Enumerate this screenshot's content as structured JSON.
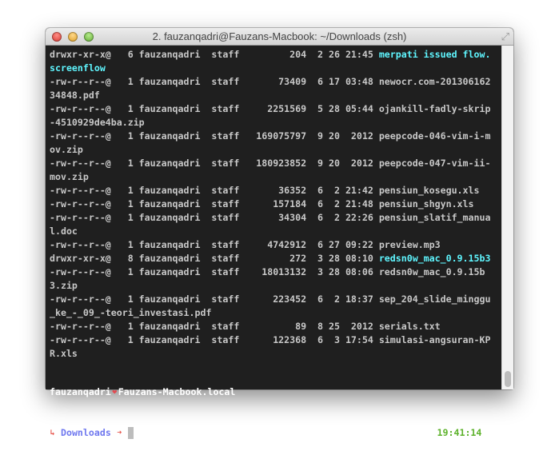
{
  "window": {
    "title": "2. fauzanqadri@Fauzans-Macbook: ~/Downloads (zsh)"
  },
  "owner": "fauzanqadri",
  "group": "staff",
  "entries": [
    {
      "perm": "drwxr-xr-x@",
      "links": "6",
      "size": "204",
      "month": "2",
      "day": "26",
      "time": "21:45",
      "name": "merpati issued flow.screenflow",
      "type": "dir"
    },
    {
      "perm": "-rw-r--r--@",
      "links": "1",
      "size": "73409",
      "month": "6",
      "day": "17",
      "time": "03:48",
      "name": "newocr.com-20130616234848.pdf",
      "type": "file"
    },
    {
      "perm": "-rw-r--r--@",
      "links": "1",
      "size": "2251569",
      "month": "5",
      "day": "28",
      "time": "05:44",
      "name": "ojankill-fadly-skrip-4510929de4ba.zip",
      "type": "file"
    },
    {
      "perm": "-rw-r--r--@",
      "links": "1",
      "size": "169075797",
      "month": "9",
      "day": "20",
      "time": "2012",
      "name": "peepcode-046-vim-i-mov.zip",
      "type": "file"
    },
    {
      "perm": "-rw-r--r--@",
      "links": "1",
      "size": "180923852",
      "month": "9",
      "day": "20",
      "time": "2012",
      "name": "peepcode-047-vim-ii-mov.zip",
      "type": "file"
    },
    {
      "perm": "-rw-r--r--@",
      "links": "1",
      "size": "36352",
      "month": "6",
      "day": "2",
      "time": "21:42",
      "name": "pensiun_kosegu.xls",
      "type": "file"
    },
    {
      "perm": "-rw-r--r--@",
      "links": "1",
      "size": "157184",
      "month": "6",
      "day": "2",
      "time": "21:48",
      "name": "pensiun_shgyn.xls",
      "type": "file"
    },
    {
      "perm": "-rw-r--r--@",
      "links": "1",
      "size": "34304",
      "month": "6",
      "day": "2",
      "time": "22:26",
      "name": "pensiun_slatif_manual.doc",
      "type": "file"
    },
    {
      "perm": "-rw-r--r--@",
      "links": "1",
      "size": "4742912",
      "month": "6",
      "day": "27",
      "time": "09:22",
      "name": "preview.mp3",
      "type": "file"
    },
    {
      "perm": "drwxr-xr-x@",
      "links": "8",
      "size": "272",
      "month": "3",
      "day": "28",
      "time": "08:10",
      "name": "redsn0w_mac_0.9.15b3",
      "type": "dir"
    },
    {
      "perm": "-rw-r--r--@",
      "links": "1",
      "size": "18013132",
      "month": "3",
      "day": "28",
      "time": "08:06",
      "name": "redsn0w_mac_0.9.15b3.zip",
      "type": "file"
    },
    {
      "perm": "-rw-r--r--@",
      "links": "1",
      "size": "223452",
      "month": "6",
      "day": "2",
      "time": "18:37",
      "name": "sep_204_slide_minggu_ke_-_09_-teori_investasi.pdf",
      "type": "file"
    },
    {
      "perm": "-rw-r--r--@",
      "links": "1",
      "size": "89",
      "month": "8",
      "day": "25",
      "time": "2012",
      "name": "serials.txt",
      "type": "file"
    },
    {
      "perm": "-rw-r--r--@",
      "links": "1",
      "size": "122368",
      "month": "6",
      "day": "3",
      "time": "17:54",
      "name": "simulasi-angsuran-KPR.xls",
      "type": "file"
    }
  ],
  "prompt": {
    "user": "fauzanqadri",
    "heart": "❤",
    "host": "Fauzans-Macbook.local",
    "return_arrow": "↳",
    "cwd": "Downloads",
    "arrow": "➜",
    "clock": "19:41:14"
  },
  "colors": {
    "dir": "#5ff6ff",
    "cwd": "#6f78ef",
    "clock": "#5db22b",
    "heart": "#e5484f"
  }
}
